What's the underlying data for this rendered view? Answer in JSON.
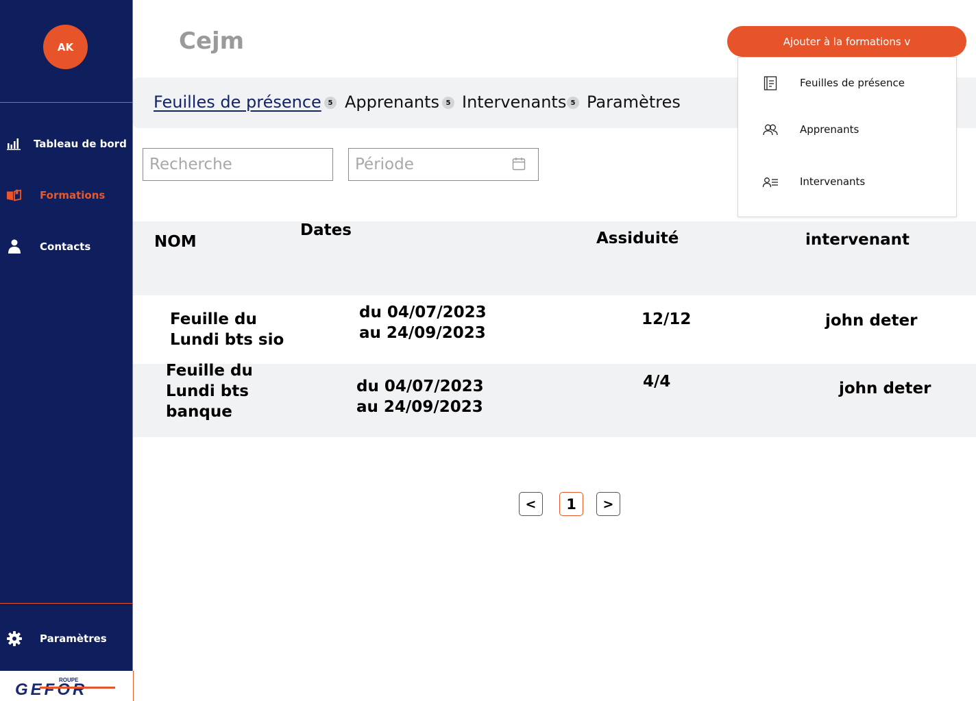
{
  "sidebar": {
    "avatar_initials": "AK",
    "nav": [
      {
        "label": "Tableau de bord",
        "icon": "bar-chart-icon"
      },
      {
        "label": "Formations",
        "icon": "book-icon",
        "active": true
      },
      {
        "label": "Contacts",
        "icon": "user-icon"
      }
    ],
    "settings_label": "Paramètres",
    "settings_icon": "gear-icon",
    "logo_text_top": "ROUPE",
    "logo_text_main": "GEFOR"
  },
  "header": {
    "title": "Cejm",
    "add_button_label": "Ajouter à la formations v"
  },
  "tabs": [
    {
      "label": "Feuilles de présence",
      "active": true,
      "badge": "5"
    },
    {
      "label": "Apprenants",
      "badge": "5"
    },
    {
      "label": "Intervenants",
      "badge": "5"
    },
    {
      "label": "Paramètres"
    }
  ],
  "filters": {
    "search_placeholder": "Recherche",
    "period_placeholder": "Période"
  },
  "table": {
    "columns": [
      "NOM",
      "Dates",
      "Assiduité",
      "intervenant"
    ],
    "rows": [
      {
        "nom_lines": [
          "Feuille du",
          "Lundi bts sio"
        ],
        "dates_lines": [
          "du 04/07/2023",
          "au 24/09/2023"
        ],
        "assiduite": "12/12",
        "intervenant": "john deter"
      },
      {
        "nom_lines": [
          "Feuille du",
          "Lundi bts",
          "banque"
        ],
        "dates_lines": [
          "du 04/07/2023",
          "au 24/09/2023"
        ],
        "assiduite": "4/4",
        "intervenant": "john deter"
      }
    ]
  },
  "pagination": {
    "prev": "<",
    "current": "1",
    "next": ">"
  },
  "dropdown": {
    "items": [
      {
        "label": "Feuilles de présence",
        "icon": "document-icon"
      },
      {
        "label": "Apprenants",
        "icon": "users-icon"
      },
      {
        "label": "Intervenants",
        "icon": "user-list-icon"
      }
    ]
  },
  "colors": {
    "sidebar_bg": "#0f1e5c",
    "accent": "#e8542a",
    "tab_bar_bg": "#f1f2f4"
  }
}
